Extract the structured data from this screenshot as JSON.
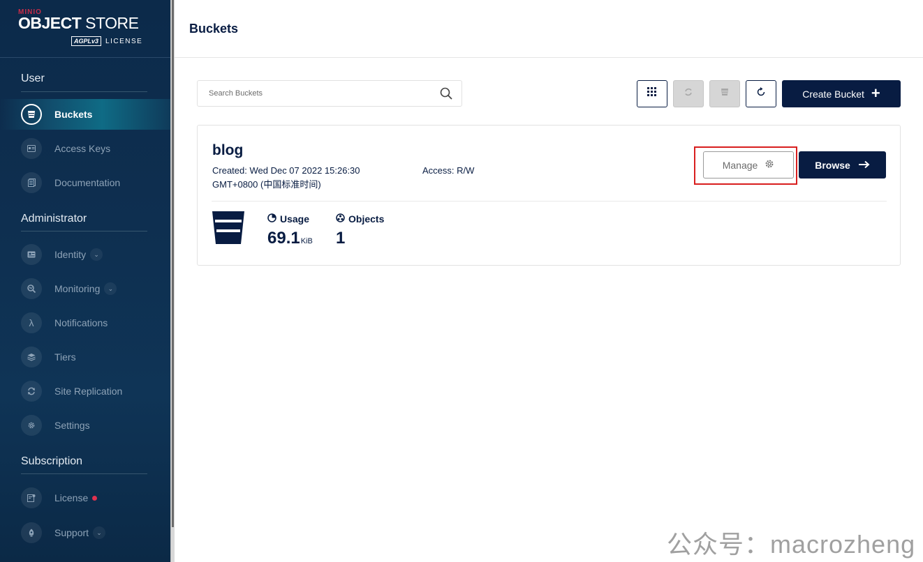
{
  "logo": {
    "minio": "MINIO",
    "brand_bold": "OBJECT",
    "brand_thin": " STORE",
    "agpl": "AGPLv3",
    "license": "LICENSE"
  },
  "sidebar": {
    "user_title": "User",
    "admin_title": "Administrator",
    "subscription_title": "Subscription",
    "items": {
      "buckets": "Buckets",
      "access_keys": "Access Keys",
      "documentation": "Documentation",
      "identity": "Identity",
      "monitoring": "Monitoring",
      "notifications": "Notifications",
      "tiers": "Tiers",
      "site_replication": "Site Replication",
      "settings": "Settings",
      "license": "License",
      "support": "Support"
    }
  },
  "header": {
    "title": "Buckets"
  },
  "search": {
    "placeholder": "Search Buckets"
  },
  "toolbar": {
    "create_label": "Create Bucket"
  },
  "bucket": {
    "name": "blog",
    "created": "Created: Wed Dec 07 2022 15:26:30 GMT+0800 (中国标准时间)",
    "access": "Access: R/W",
    "manage_label": "Manage",
    "browse_label": "Browse",
    "usage_label": "Usage",
    "usage_value": "69.1",
    "usage_unit": "KiB",
    "objects_label": "Objects",
    "objects_value": "1"
  },
  "colors": {
    "primary": "#081c42",
    "sidebar": "#0e2f50",
    "highlight": "#d81e1e",
    "alert": "#e0324f"
  },
  "watermark": "公众号：macrozheng"
}
